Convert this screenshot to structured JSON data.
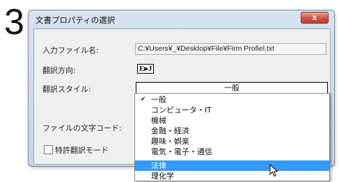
{
  "step_number": "3",
  "dialog": {
    "title": "文書プロパティの選択",
    "close_label": "x",
    "input_file_label": "入力ファイル名:",
    "input_file_value": "C:¥Users¥_¥Desktop¥File¥Firm Profiel.txt",
    "direction_label": "翻訳方向:",
    "direction_value": "E▸J",
    "style_label": "翻訳スタイル:",
    "style_value": "一般",
    "char_code_label": "ファイルの文字コード:",
    "patent_label": "特許翻訳モード"
  },
  "dropdown": {
    "checked_item": "一般",
    "selected_item": "法律",
    "items": [
      "一般",
      "コンピュータ・IT",
      "機械",
      "金融・経済",
      "趣味・娯楽",
      "電気・電子・通信",
      "法律",
      "理化学"
    ]
  },
  "colors": {
    "selection": "#3399ff",
    "close_button": "#c94a38"
  },
  "icons": {
    "cursor": "mouse-pointer-icon",
    "check": "checkmark-icon"
  }
}
